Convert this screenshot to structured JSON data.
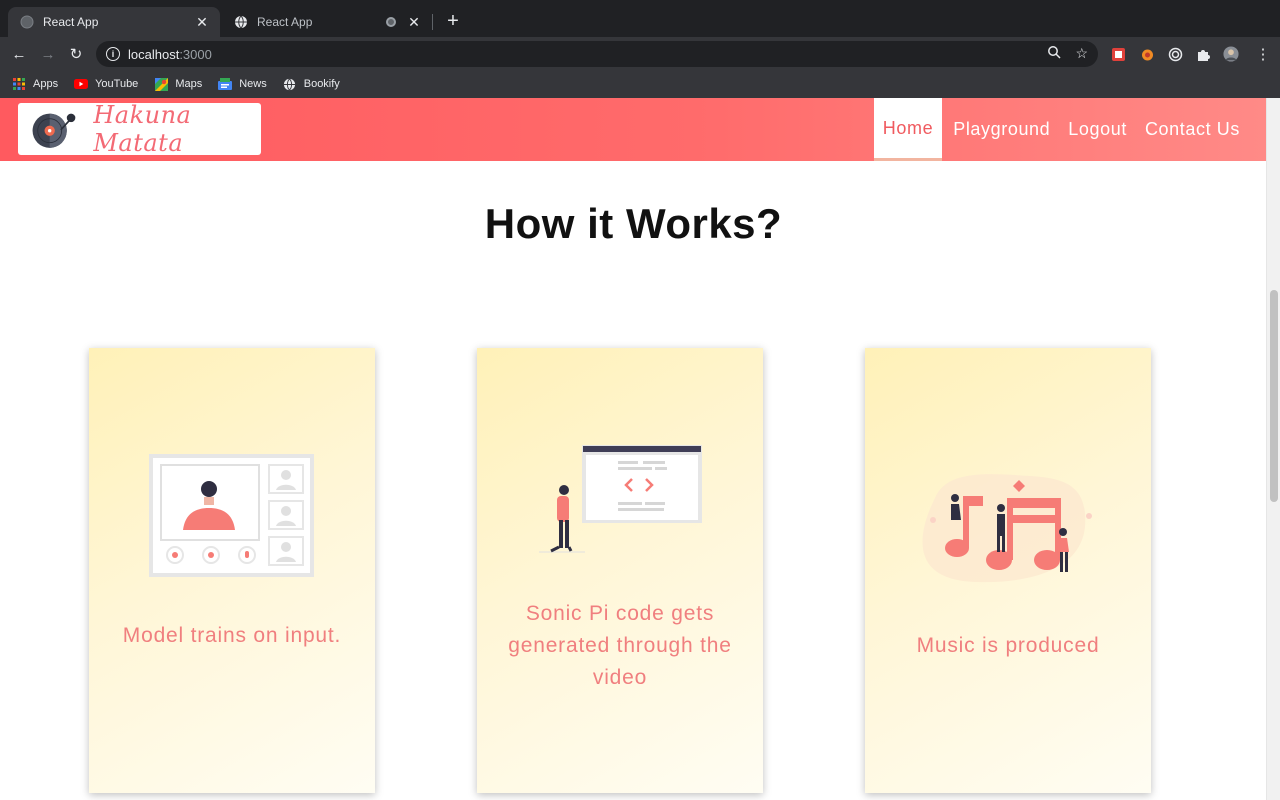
{
  "browser": {
    "tabs": [
      {
        "title": "React App",
        "active": true
      },
      {
        "title": "React App",
        "active": false
      }
    ],
    "url": {
      "host": "localhost",
      "port": ":3000"
    },
    "bookmarks": [
      {
        "label": "Apps",
        "icon": "apps-grid-icon"
      },
      {
        "label": "YouTube",
        "icon": "youtube-icon"
      },
      {
        "label": "Maps",
        "icon": "maps-icon"
      },
      {
        "label": "News",
        "icon": "news-icon"
      },
      {
        "label": "Bookify",
        "icon": "globe-icon"
      }
    ]
  },
  "navbar": {
    "logo_text": "Hakuna Matata",
    "links": [
      "Home",
      "Playground",
      "Logout",
      "Contact Us"
    ],
    "active_link": "Home",
    "colors": {
      "gradient_start": "#ff5a5f",
      "gradient_end": "#ff8a87",
      "active_text": "#f05a5f"
    }
  },
  "main": {
    "title": "How it Works?",
    "cards": [
      {
        "caption": "Model trains on input.",
        "illustration": "video-call-illustration"
      },
      {
        "caption": "Sonic Pi code gets generated through the video",
        "illustration": "code-screen-illustration"
      },
      {
        "caption": "Music is produced",
        "illustration": "music-notes-illustration"
      }
    ],
    "caption_color": "#f07f7f"
  }
}
